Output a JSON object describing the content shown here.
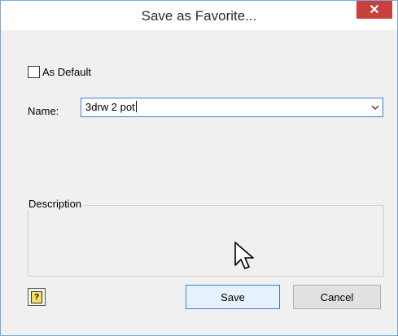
{
  "dialog": {
    "title": "Save as Favorite...",
    "close_icon": "close-icon",
    "as_default": {
      "label": "As Default",
      "checked": false
    },
    "name": {
      "label": "Name:",
      "value": "3drw 2 pot"
    },
    "description": {
      "legend": "Description",
      "value": ""
    },
    "help_icon": "help-icon",
    "buttons": {
      "save": "Save",
      "cancel": "Cancel"
    }
  },
  "colors": {
    "close_button": "#c7403a",
    "focus_border": "#3c7fd1",
    "dialog_background": "#f0f0f0"
  }
}
